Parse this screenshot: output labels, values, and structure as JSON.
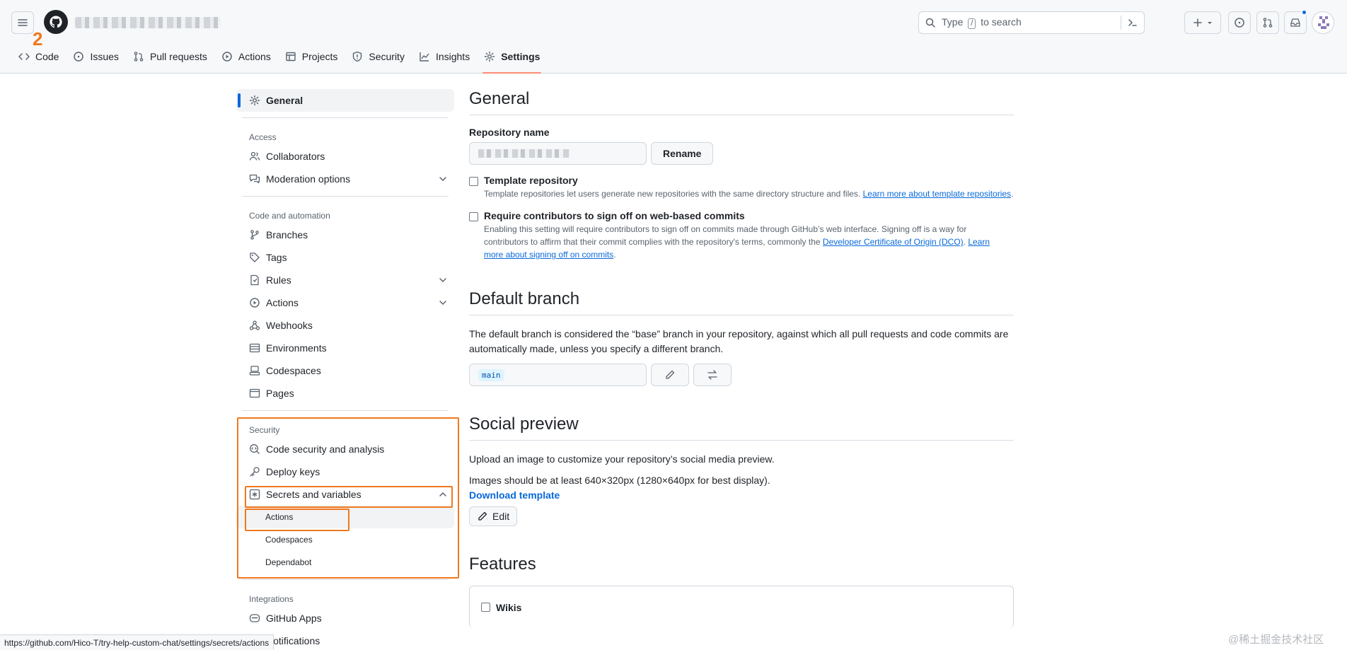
{
  "header": {
    "step_marker": "2",
    "search_placeholder_pre": "Type",
    "search_key": "/",
    "search_placeholder_post": "to search"
  },
  "tabs": [
    {
      "label": "Code"
    },
    {
      "label": "Issues"
    },
    {
      "label": "Pull requests"
    },
    {
      "label": "Actions"
    },
    {
      "label": "Projects"
    },
    {
      "label": "Security"
    },
    {
      "label": "Insights"
    },
    {
      "label": "Settings"
    }
  ],
  "sidebar": {
    "general": "General",
    "access_heading": "Access",
    "collaborators": "Collaborators",
    "moderation": "Moderation options",
    "code_heading": "Code and automation",
    "branches": "Branches",
    "tags": "Tags",
    "rules": "Rules",
    "actions": "Actions",
    "webhooks": "Webhooks",
    "environments": "Environments",
    "codespaces": "Codespaces",
    "pages": "Pages",
    "security_heading": "Security",
    "code_security": "Code security and analysis",
    "deploy_keys": "Deploy keys",
    "secrets": "Secrets and variables",
    "secrets_actions": "Actions",
    "secrets_codespaces": "Codespaces",
    "secrets_dependabot": "Dependabot",
    "integrations_heading": "Integrations",
    "github_apps": "GitHub Apps",
    "notifications": "Notifications"
  },
  "main": {
    "general_title": "General",
    "repo_name_label": "Repository name",
    "rename_button": "Rename",
    "template_title": "Template repository",
    "template_note": "Template repositories let users generate new repositories with the same directory structure and files.",
    "template_link": "Learn more about template repositories",
    "signoff_title": "Require contributors to sign off on web-based commits",
    "signoff_note": "Enabling this setting will require contributors to sign off on commits made through GitHub’s web interface. Signing off is a way for contributors to affirm that their commit complies with the repository's terms, commonly the",
    "signoff_link1": "Developer Certificate of Origin (DCO)",
    "signoff_link2": "Learn more about signing off on commits",
    "default_branch_title": "Default branch",
    "default_branch_text": "The default branch is considered the “base” branch in your repository, against which all pull requests and code commits are automatically made, unless you specify a different branch.",
    "branch_name": "main",
    "social_title": "Social preview",
    "social_text1": "Upload an image to customize your repository’s social media preview.",
    "social_text2": "Images should be at least 640×320px (1280×640px for best display).",
    "download_template": "Download template",
    "edit_button": "Edit",
    "features_title": "Features",
    "wikis": "Wikis"
  },
  "status_url": "https://github.com/Hico-T/try-help-custom-chat/settings/secrets/actions",
  "watermark": "@稀土掘金技术社区",
  "colors": {
    "accent": "#0969da",
    "highlight": "#f0781e",
    "tab_underline": "#fd8c73"
  }
}
